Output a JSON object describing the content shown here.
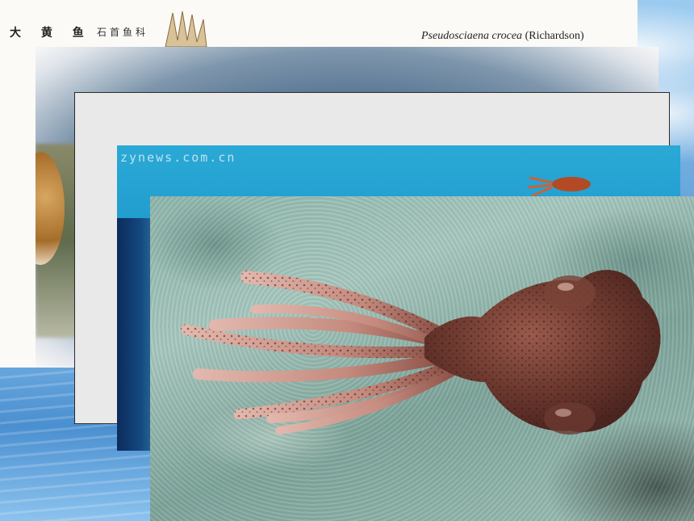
{
  "image": {
    "slides": {
      "fish_sheet": {
        "title_cn": "大 黄 鱼",
        "family_cn": "石首鱼科",
        "latin_name": "Pseudosciaena crocea",
        "latin_author": "(Richardson)"
      },
      "ocean_photo": {
        "watermark": "zynews.com.cn"
      }
    }
  }
}
